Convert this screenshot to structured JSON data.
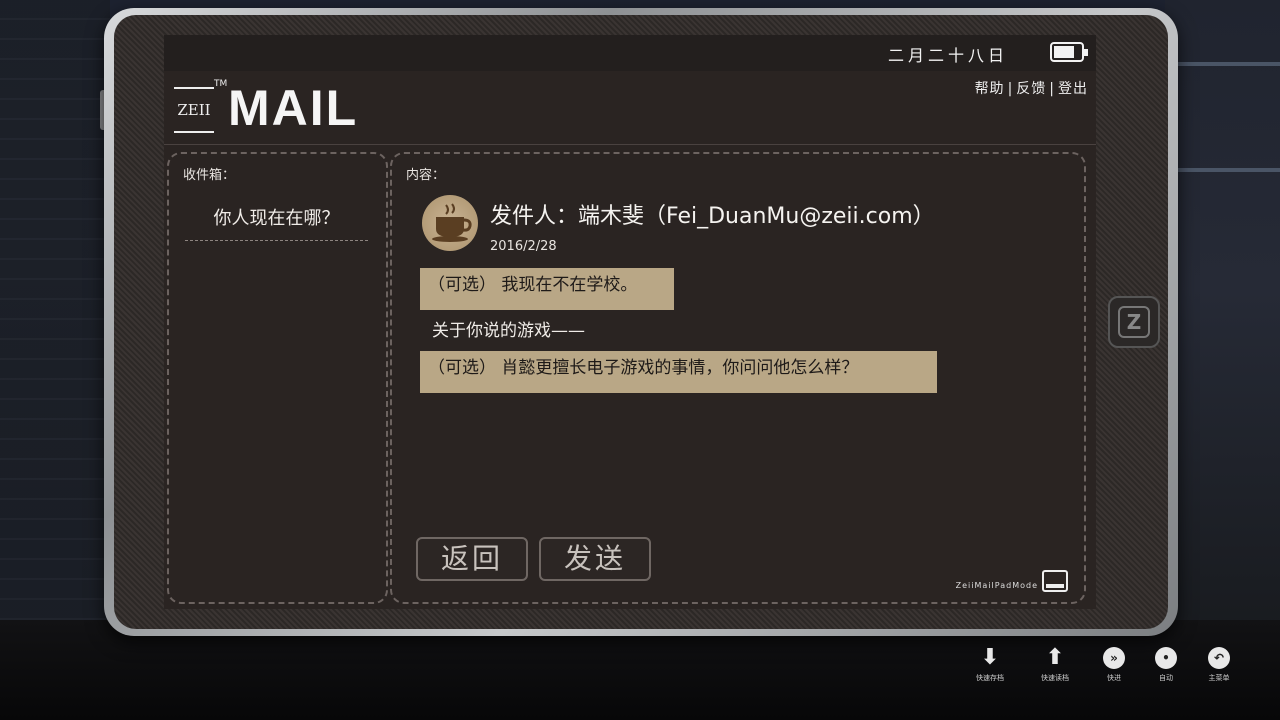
{
  "status": {
    "date": "二月二十八日"
  },
  "header": {
    "logo_text": "ZEII",
    "logo_tm": "TM",
    "app_name": "MAIL",
    "links": [
      "帮助",
      "反馈",
      "登出"
    ],
    "separator": "|"
  },
  "inbox": {
    "title": "收件箱：",
    "items": [
      "你人现在在哪？"
    ]
  },
  "content": {
    "title": "内容：",
    "sender": "发件人：端木斐（Fei_DuanMu@zeii.com）",
    "date": "2016/2/28",
    "option1": "（可选） 我现在不在学校。",
    "line": "关于你说的游戏——",
    "option2": "（可选） 肖懿更擅长电子游戏的事情，你问问他怎么样？"
  },
  "buttons": {
    "back": "返回",
    "send": "发送"
  },
  "mode_label": "ZeiiMailPadMode",
  "game_menu": [
    {
      "icon": "quick-save-icon",
      "label": "快速存档"
    },
    {
      "icon": "quick-load-icon",
      "label": "快速读档"
    },
    {
      "icon": "fast-forward-icon",
      "label": "快进"
    },
    {
      "icon": "auto-icon",
      "label": "自动"
    },
    {
      "icon": "main-menu-icon",
      "label": "主菜单"
    }
  ]
}
